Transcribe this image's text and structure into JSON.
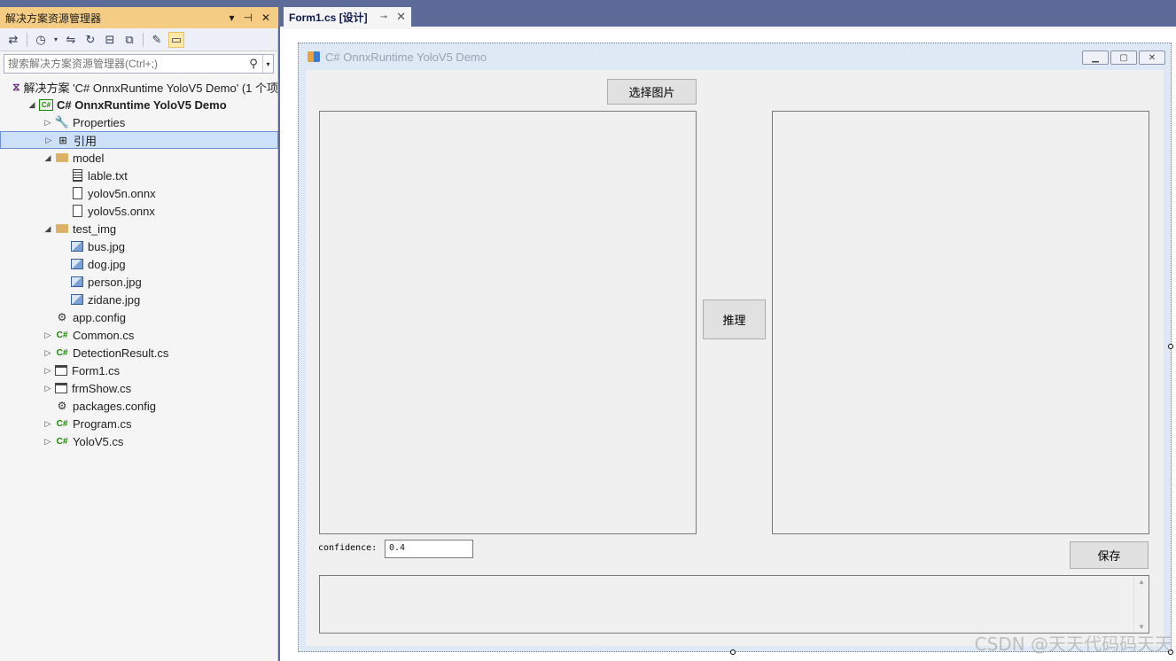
{
  "solution_explorer": {
    "title": "解决方案资源管理器",
    "title_buttons": [
      "▾",
      "⊣",
      "✕"
    ],
    "search_placeholder": "搜索解决方案资源管理器(Ctrl+;)",
    "tree": [
      {
        "label": "解决方案 'C# OnnxRuntime YoloV5 Demo' (1 个项",
        "icon": "solution-icon",
        "indent": 0,
        "expander": ""
      },
      {
        "label": "C# OnnxRuntime YoloV5 Demo",
        "icon": "csharp-project-icon",
        "indent": 1,
        "expander": "◢",
        "bold": true
      },
      {
        "label": "Properties",
        "icon": "wrench-icon",
        "indent": 2,
        "expander": "▷"
      },
      {
        "label": "引用",
        "icon": "references-icon",
        "indent": 2,
        "expander": "▷",
        "selected": true
      },
      {
        "label": "model",
        "icon": "folder-icon",
        "indent": 2,
        "expander": "◢"
      },
      {
        "label": "lable.txt",
        "icon": "text-file-icon",
        "indent": 3,
        "expander": ""
      },
      {
        "label": "yolov5n.onnx",
        "icon": "file-icon",
        "indent": 3,
        "expander": ""
      },
      {
        "label": "yolov5s.onnx",
        "icon": "file-icon",
        "indent": 3,
        "expander": ""
      },
      {
        "label": "test_img",
        "icon": "folder-icon",
        "indent": 2,
        "expander": "◢"
      },
      {
        "label": "bus.jpg",
        "icon": "image-icon",
        "indent": 3,
        "expander": ""
      },
      {
        "label": "dog.jpg",
        "icon": "image-icon",
        "indent": 3,
        "expander": ""
      },
      {
        "label": "person.jpg",
        "icon": "image-icon",
        "indent": 3,
        "expander": ""
      },
      {
        "label": "zidane.jpg",
        "icon": "image-icon",
        "indent": 3,
        "expander": ""
      },
      {
        "label": "app.config",
        "icon": "config-icon",
        "indent": 2,
        "expander": ""
      },
      {
        "label": "Common.cs",
        "icon": "csharp-file-icon",
        "indent": 2,
        "expander": "▷"
      },
      {
        "label": "DetectionResult.cs",
        "icon": "csharp-file-icon",
        "indent": 2,
        "expander": "▷"
      },
      {
        "label": "Form1.cs",
        "icon": "form-icon",
        "indent": 2,
        "expander": "▷"
      },
      {
        "label": "frmShow.cs",
        "icon": "form-icon",
        "indent": 2,
        "expander": "▷"
      },
      {
        "label": "packages.config",
        "icon": "config-icon",
        "indent": 2,
        "expander": ""
      },
      {
        "label": "Program.cs",
        "icon": "csharp-file-icon",
        "indent": 2,
        "expander": "▷"
      },
      {
        "label": "YoloV5.cs",
        "icon": "csharp-file-icon",
        "indent": 2,
        "expander": "▷"
      }
    ]
  },
  "editor_tab": {
    "label": "Form1.cs [设计]",
    "pin": "⊸",
    "close": "✕"
  },
  "form": {
    "title": "C# OnnxRuntime YoloV5 Demo",
    "select_image_button": "选择图片",
    "infer_button": "推理",
    "save_button": "保存",
    "confidence_label": "confidence:",
    "confidence_value": "0.4"
  },
  "watermark": "CSDN @天天代码码天天",
  "colors": {
    "accent_title": "#f5cc84",
    "chrome": "#5d6b99",
    "selection": "#cce0fa"
  }
}
